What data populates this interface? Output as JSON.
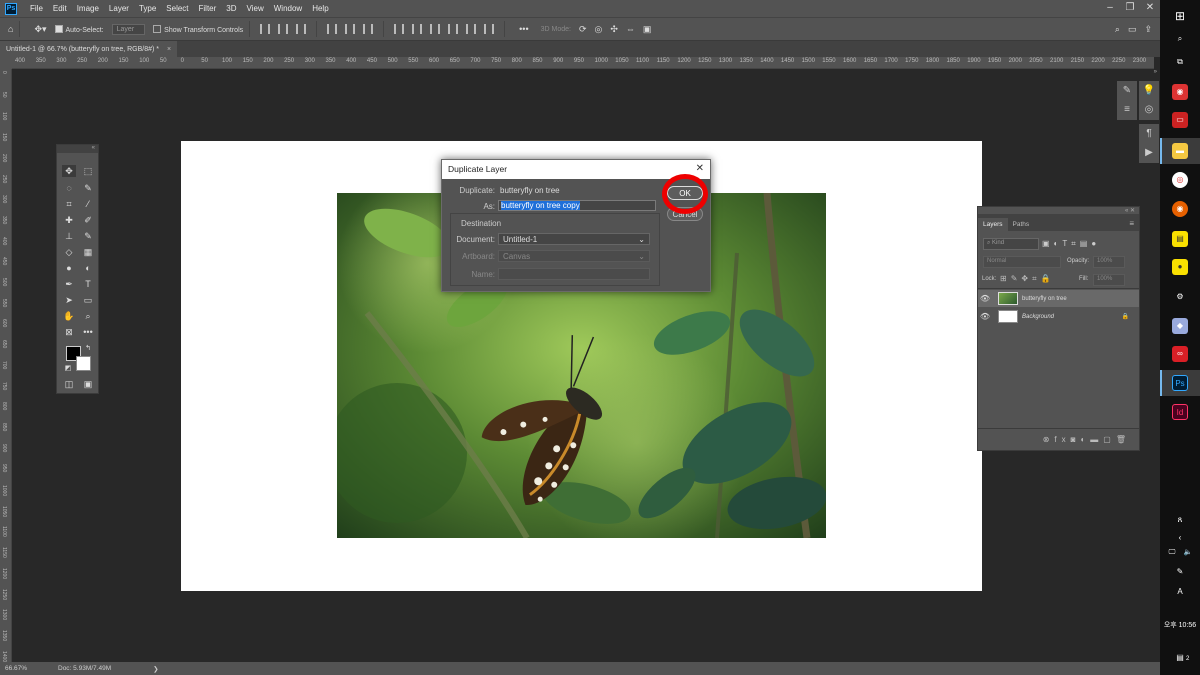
{
  "menu": [
    "File",
    "Edit",
    "Image",
    "Layer",
    "Type",
    "Select",
    "Filter",
    "3D",
    "View",
    "Window",
    "Help"
  ],
  "options": {
    "auto_select_label": "Auto-Select:",
    "auto_select_target": "Layer",
    "transform_label": "Show Transform Controls",
    "mode_label": "3D Mode:"
  },
  "doc_tab": {
    "title": "Untitled-1 @ 66.7% (butteryfly on tree, RGB/8#) *",
    "close": "×"
  },
  "ruler_h": [
    "400",
    "350",
    "300",
    "250",
    "200",
    "150",
    "100",
    "50",
    "0",
    "50",
    "100",
    "150",
    "200",
    "250",
    "300",
    "350",
    "400",
    "450",
    "500",
    "550",
    "600",
    "650",
    "700",
    "750",
    "800",
    "850",
    "900",
    "950",
    "1000",
    "1050",
    "1100",
    "1150",
    "1200",
    "1250",
    "1300",
    "1350",
    "1400",
    "1450",
    "1500",
    "1550",
    "1600",
    "1650",
    "1700",
    "1750",
    "1800",
    "1850",
    "1900",
    "1950",
    "2000",
    "2050",
    "2100",
    "2150",
    "2200",
    "2250",
    "2300"
  ],
  "ruler_v": [
    "0",
    "50",
    "100",
    "150",
    "200",
    "250",
    "300",
    "350",
    "400",
    "450",
    "500",
    "550",
    "600",
    "650",
    "700",
    "750",
    "800",
    "850",
    "900",
    "950",
    "1000",
    "1050",
    "1100",
    "1150",
    "1200",
    "1250",
    "1300",
    "1350",
    "1400",
    "1450"
  ],
  "dialog": {
    "title": "Duplicate Layer",
    "close": "✕",
    "duplicate_label": "Duplicate:",
    "duplicate_value": "butteryfly on tree",
    "as_label": "As:",
    "as_value": "butteryfly on tree copy",
    "destination_label": "Destination",
    "document_label": "Document:",
    "document_value": "Untitled-1",
    "artboard_label": "Artboard:",
    "artboard_value": "Canvas",
    "name_label": "Name:",
    "ok_label": "OK",
    "cancel_label": "Cancel"
  },
  "layers_panel": {
    "tabs": [
      "Layers",
      "Paths"
    ],
    "kind_placeholder": "Kind",
    "blend_mode": "Normal",
    "opacity_label": "Opacity:",
    "opacity_value": "100%",
    "lock_label": "Lock:",
    "fill_label": "Fill:",
    "fill_value": "100%",
    "layers": [
      {
        "name": "butteryfly on tree",
        "selected": true
      },
      {
        "name": "Background",
        "selected": false
      }
    ]
  },
  "status": {
    "zoom": "66.67%",
    "doc": "Doc: 5.93M/7.49M",
    "arrow": "❯"
  },
  "taskbar": {
    "time": "오후 10:56",
    "lang": "A",
    "notif": "2"
  },
  "colors": {
    "accent": "#31a8ff",
    "highlight_circle": "#e00000",
    "selection": "#1e6fd9"
  }
}
